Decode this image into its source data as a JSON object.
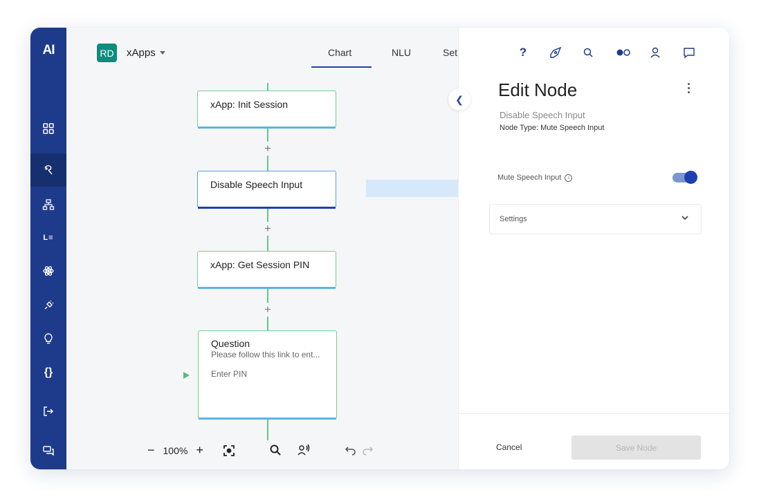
{
  "rail": {
    "logo": "AI",
    "items": [
      {
        "icon": "grid-icon"
      },
      {
        "icon": "paint-brush-icon",
        "active": true
      },
      {
        "icon": "flowchart-icon"
      },
      {
        "icon": "list-icon",
        "text": "L≡"
      },
      {
        "icon": "atom-icon"
      },
      {
        "icon": "plug-icon"
      },
      {
        "icon": "lightbulb-icon"
      },
      {
        "icon": "code-braces-icon",
        "text": "{}"
      },
      {
        "icon": "logout-icon"
      },
      {
        "icon": "chat-icon"
      }
    ]
  },
  "header": {
    "avatar": "RD",
    "app_name": "xApps",
    "tabs": [
      {
        "label": "Chart",
        "active": true
      },
      {
        "label": "NLU"
      },
      {
        "label": "Set"
      }
    ]
  },
  "flow": {
    "nodes": [
      {
        "title": "xApp: Init Session"
      },
      {
        "title": "Disable Speech Input",
        "selected": true
      },
      {
        "title": "xApp: Get Session PIN"
      },
      {
        "title": "Question",
        "subtitle": "Please follow this link to ent...",
        "option": "Enter PIN"
      }
    ],
    "add_symbol": "+"
  },
  "toolbar": {
    "zoom_out": "−",
    "zoom": "100%",
    "zoom_in": "+"
  },
  "panel": {
    "top_icons": [
      "help-icon",
      "compass-icon",
      "search-icon",
      "toggle-dots-icon",
      "user-icon",
      "comment-icon"
    ],
    "help_label": "?",
    "title": "Edit Node",
    "node_name": "Disable Speech Input",
    "node_type": "Node Type: Mute Speech Input",
    "toggle_label": "Mute Speech Input",
    "toggle_on": true,
    "settings_label": "Settings",
    "cancel_label": "Cancel",
    "save_label": "Save Node"
  },
  "colors": {
    "rail": "#1e3a8a",
    "accent": "#1e40af",
    "node_border": "#72d195",
    "teal_avatar": "#0f8b7e"
  }
}
